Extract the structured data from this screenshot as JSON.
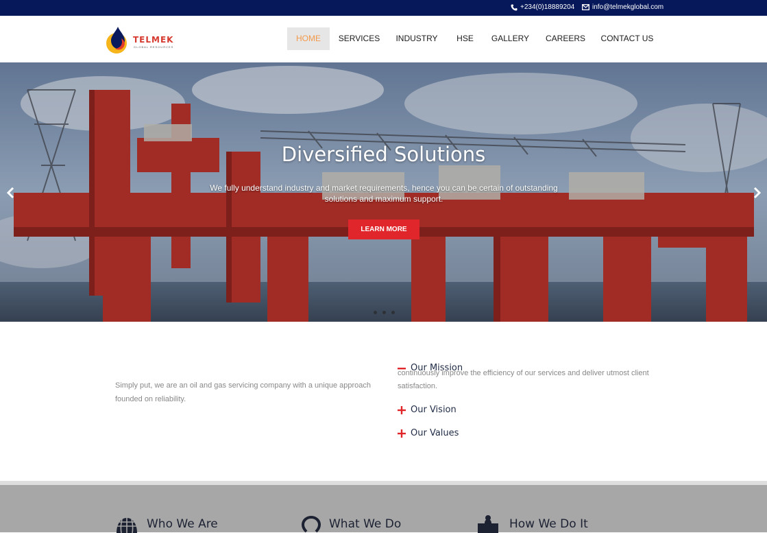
{
  "topbar": {
    "phone": "+234(0)18889204",
    "email": "info@telmekglobal.com"
  },
  "brand": {
    "name": "TELMEK",
    "tagline": "GLOBAL RESOURCES",
    "accent": "#d63a2f"
  },
  "nav": {
    "items": [
      {
        "label": "HOME",
        "active": true
      },
      {
        "label": "SERVICES",
        "active": false
      },
      {
        "label": "INDUSTRY",
        "active": false
      },
      {
        "label": "HSE",
        "active": false
      },
      {
        "label": "GALLERY",
        "active": false
      },
      {
        "label": "CAREERS",
        "active": false
      },
      {
        "label": "CONTACT US",
        "active": false
      }
    ],
    "active_color": "#f39a4a"
  },
  "hero": {
    "title": "Diversified Solutions",
    "text": "We fully understand industry and market requirements, hence you can be certain of outstanding solutions and maximum support.",
    "button": "LEARN MORE",
    "button_color": "#e0262a",
    "slide_count": 3
  },
  "about": {
    "intro": "Simply put, we are an oil and gas servicing company with a unique approach founded on reliability.",
    "accordion": [
      {
        "title": "Our Mission",
        "expanded": true,
        "content": "continuously improve the efficiency of our services and deliver utmost client satisfaction."
      },
      {
        "title": "Our Vision",
        "expanded": false
      },
      {
        "title": "Our Values",
        "expanded": false
      }
    ]
  },
  "features": [
    {
      "title": "Who We Are",
      "icon": "globe-icon"
    },
    {
      "title": "What We Do",
      "icon": "target-icon"
    },
    {
      "title": "How We Do It",
      "icon": "puzzle-icon"
    }
  ],
  "colors": {
    "topbar": "#07185a",
    "features_bg": "#a7a7a7",
    "heading": "#1f2a44"
  }
}
